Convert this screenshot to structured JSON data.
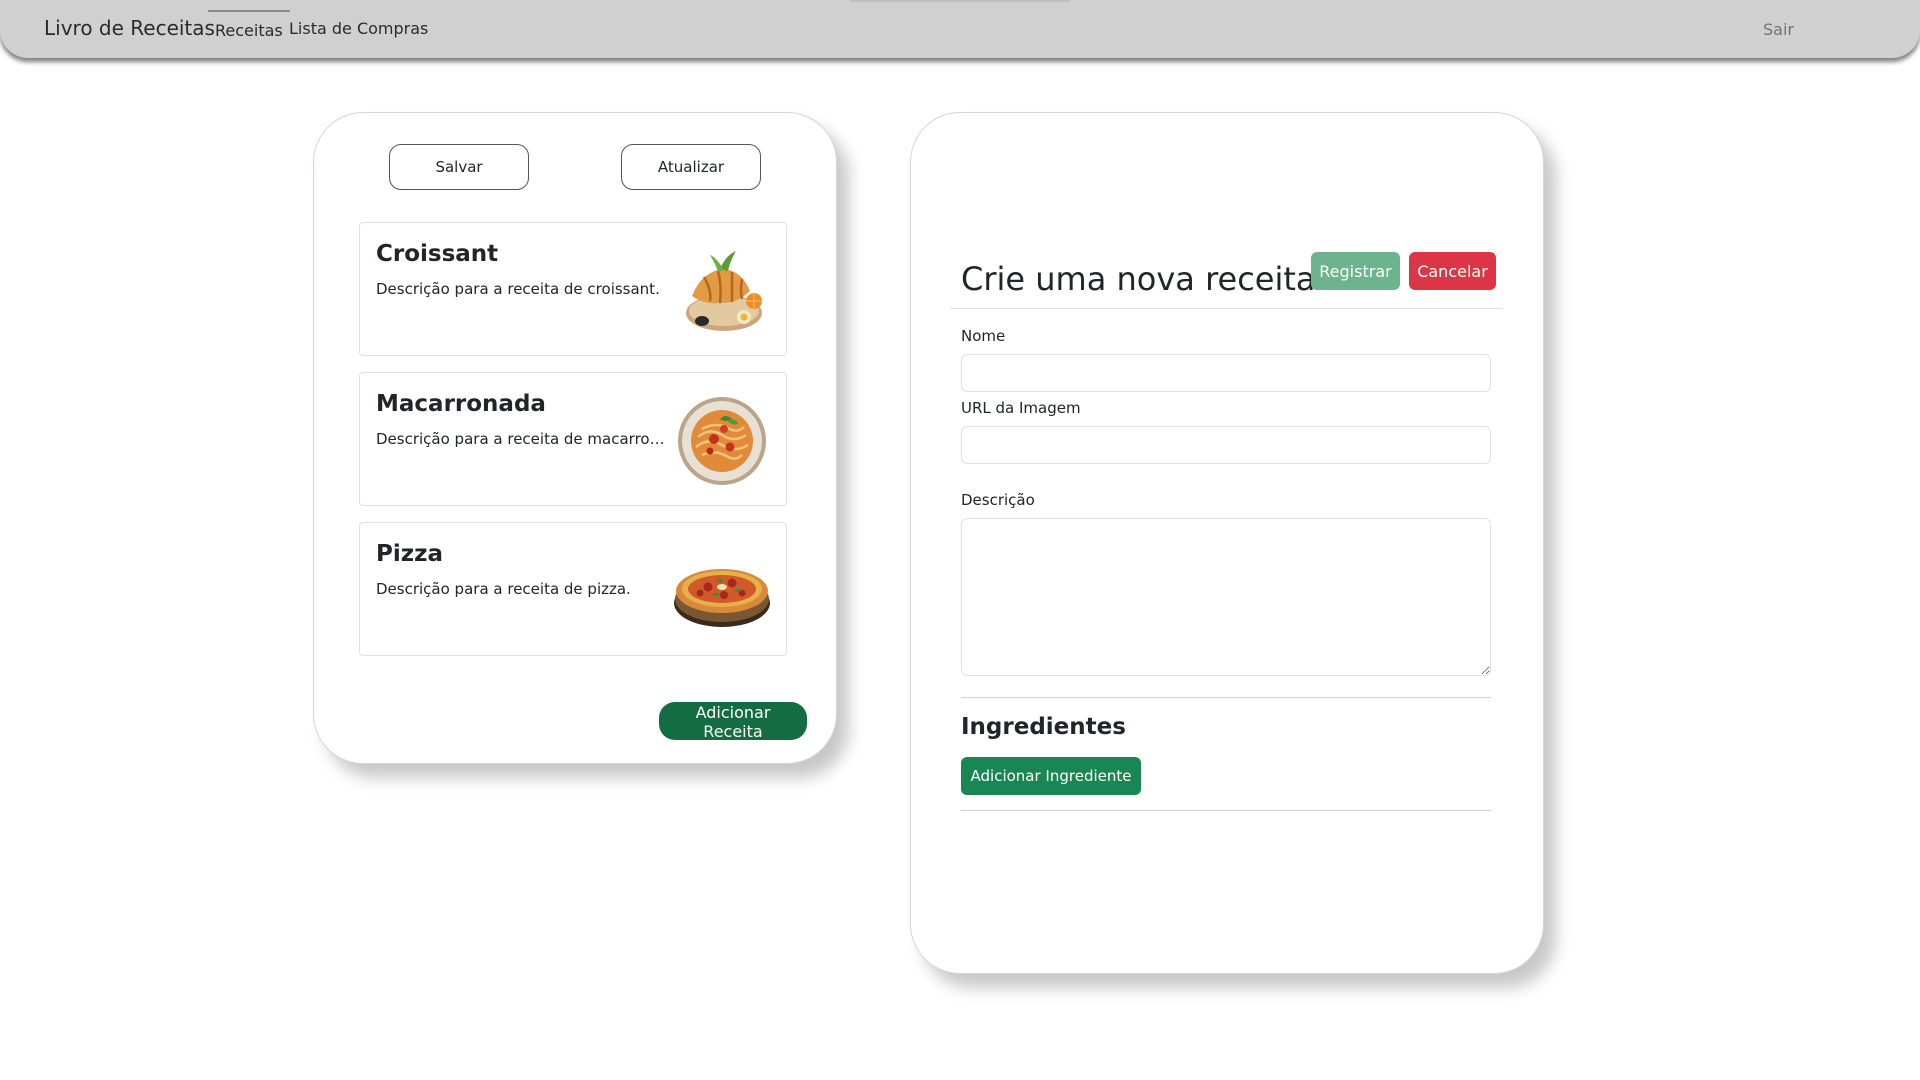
{
  "navbar": {
    "brand": "Livro de Receitas",
    "links": [
      {
        "label": "Receitas",
        "active": true
      },
      {
        "label": "Lista de Compras",
        "active": false
      }
    ],
    "logout_label": "Sair"
  },
  "recipes_panel": {
    "save_label": "Salvar",
    "update_label": "Atualizar",
    "recipes": [
      {
        "name": "Croissant",
        "description": "Descrição para a receita de croissant.",
        "image": "croissant-image"
      },
      {
        "name": "Macarronada",
        "description": "Descrição para a receita de macarronada.",
        "image": "pasta-image"
      },
      {
        "name": "Pizza",
        "description": "Descrição para a receita de pizza.",
        "image": "pizza-image"
      }
    ],
    "add_recipe_label": "Adicionar Receita"
  },
  "recipe_form": {
    "title": "Crie uma nova receita",
    "register_label": "Registrar",
    "cancel_label": "Cancelar",
    "name_label": "Nome",
    "name_value": "",
    "image_url_label": "URL da Imagem",
    "image_url_value": "",
    "description_label": "Descrição",
    "description_value": "",
    "ingredients_title": "Ingredientes",
    "add_ingredient_label": "Adicionar Ingrediente"
  },
  "colors": {
    "navbar_bg": "#d0d0d0",
    "success": "#198754",
    "success_dark": "#146c43",
    "success_muted": "#6cb38e",
    "danger": "#dc3545"
  }
}
